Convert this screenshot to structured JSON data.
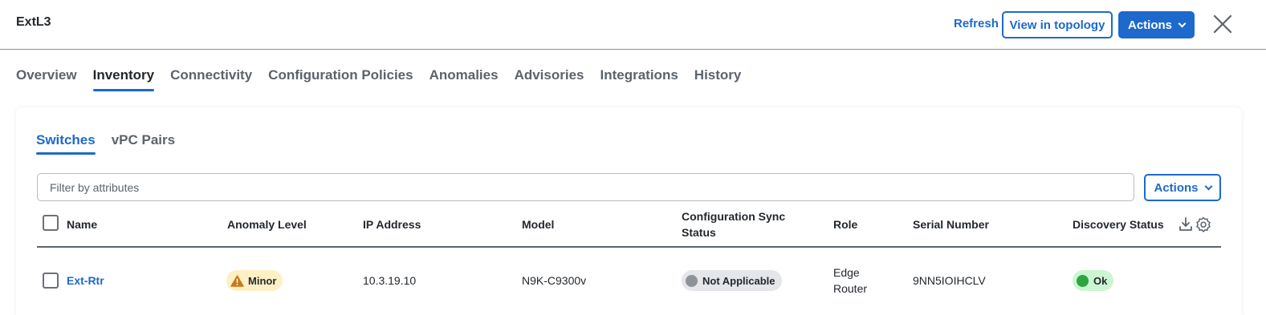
{
  "header": {
    "title": "ExtL3",
    "refresh_label": "Refresh",
    "view_topology_label": "View in topology",
    "actions_label": "Actions"
  },
  "tabs": [
    {
      "label": "Overview",
      "active": false
    },
    {
      "label": "Inventory",
      "active": true
    },
    {
      "label": "Connectivity",
      "active": false
    },
    {
      "label": "Configuration Policies",
      "active": false
    },
    {
      "label": "Anomalies",
      "active": false
    },
    {
      "label": "Advisories",
      "active": false
    },
    {
      "label": "Integrations",
      "active": false
    },
    {
      "label": "History",
      "active": false
    }
  ],
  "subtabs": [
    {
      "label": "Switches",
      "active": true
    },
    {
      "label": "vPC Pairs",
      "active": false
    }
  ],
  "filter": {
    "placeholder": "Filter by attributes"
  },
  "table_actions_label": "Actions",
  "table": {
    "columns": {
      "name": "Name",
      "anomaly": "Anomaly Level",
      "ip": "IP Address",
      "model": "Model",
      "config_sync_1": "Configuration Sync",
      "config_sync_2": "Status",
      "role": "Role",
      "serial": "Serial Number",
      "discovery": "Discovery Status"
    },
    "rows": [
      {
        "name": "Ext-Rtr",
        "anomaly": "Minor",
        "ip": "10.3.19.10",
        "model": "N9K-C9300v",
        "config_sync": "Not Applicable",
        "role_1": "Edge",
        "role_2": "Router",
        "serial": "9NN5IOIHCLV",
        "discovery": "Ok"
      }
    ]
  },
  "colors": {
    "accent": "#1d69cc",
    "minor_warning": "#c9781b",
    "not_applicable": "#8e9399",
    "ok": "#2ba640"
  },
  "icons": [
    "close-icon",
    "chevron-down-icon",
    "warning-icon",
    "download-icon",
    "gear-icon"
  ]
}
